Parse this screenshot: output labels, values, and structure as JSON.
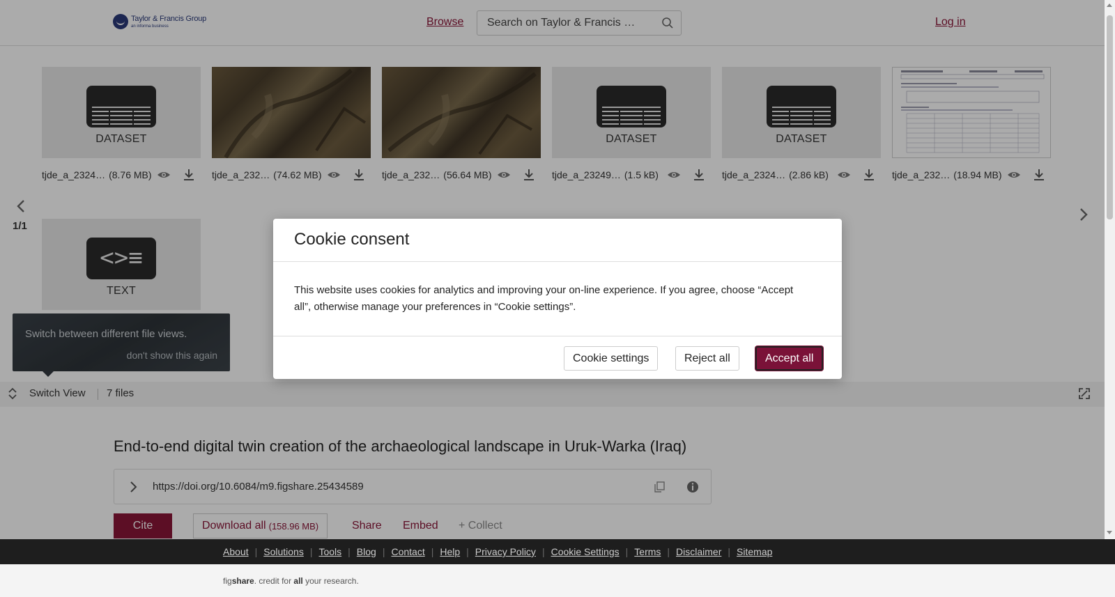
{
  "header": {
    "logo_main": "Taylor & Francis Group",
    "logo_sub": "an informa business",
    "browse": "Browse",
    "search_placeholder": "Search on Taylor & Francis …",
    "login": "Log in"
  },
  "files": [
    {
      "name": "tjde_a_2324…",
      "size": "(8.76 MB)",
      "kind": "DATASET"
    },
    {
      "name": "tjde_a_232…",
      "size": "(74.62 MB)",
      "kind": "image"
    },
    {
      "name": "tjde_a_232…",
      "size": "(56.64 MB)",
      "kind": "image"
    },
    {
      "name": "tjde_a_23249…",
      "size": "(1.5 kB)",
      "kind": "DATASET"
    },
    {
      "name": "tjde_a_2324…",
      "size": "(2.86 kB)",
      "kind": "DATASET"
    },
    {
      "name": "tjde_a_232…",
      "size": "(18.94 MB)",
      "kind": "document"
    },
    {
      "name": "",
      "size": "",
      "kind": "TEXT"
    }
  ],
  "viewer": {
    "page_indicator": "1/1",
    "tooltip_text": "Switch between different file views.",
    "tooltip_dismiss": "don't show this again",
    "switch_view": "Switch View",
    "files_count": "7 files"
  },
  "article": {
    "title": "End-to-end digital twin creation of the archaeological landscape in Uruk-Warka (Iraq)",
    "doi": "https://doi.org/10.6084/m9.figshare.25434589",
    "cite": "Cite",
    "download_all": "Download all",
    "download_size": "(158.96 MB)",
    "share": "Share",
    "embed": "Embed",
    "collect": "+ Collect"
  },
  "modal": {
    "title": "Cookie consent",
    "body": "This website uses cookies for analytics and improving your on-line experience. If you agree, choose “Accept all”, otherwise manage your preferences in “Cookie settings”.",
    "settings": "Cookie settings",
    "reject": "Reject all",
    "accept": "Accept all"
  },
  "footer": {
    "links": [
      "About",
      "Solutions",
      "Tools",
      "Blog",
      "Contact",
      "Help",
      "Privacy Policy",
      "Cookie Settings",
      "Terms",
      "Disclaimer",
      "Sitemap"
    ],
    "tagline_pre": "fig",
    "tagline_brand": "share",
    "tagline_mid": ". credit for ",
    "tagline_all": "all",
    "tagline_post": " your research."
  },
  "colors": {
    "accent": "#8a1538",
    "footer_bg": "#1e1e1e"
  }
}
